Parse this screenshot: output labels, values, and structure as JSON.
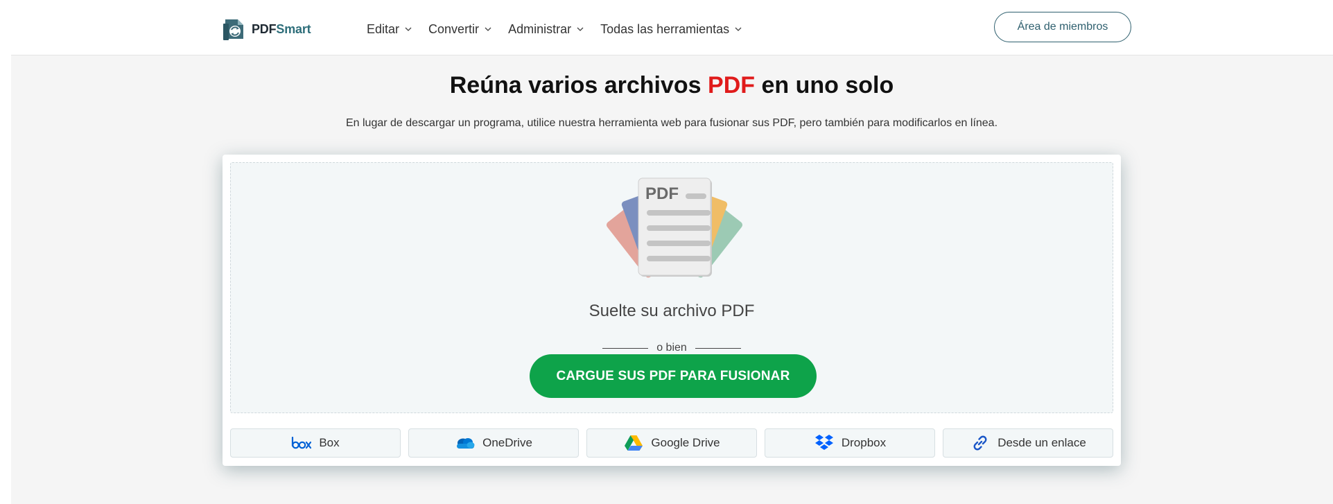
{
  "header": {
    "logo": {
      "pdf": "PDF",
      "smart": "Smart"
    },
    "nav": [
      {
        "label": "Editar"
      },
      {
        "label": "Convertir"
      },
      {
        "label": "Administrar"
      },
      {
        "label": "Todas las herramientas"
      }
    ],
    "member_button": "Área de miembros"
  },
  "hero": {
    "title_before": "Reúna varios archivos ",
    "title_accent": "PDF",
    "title_after": " en uno solo",
    "subtitle": "En lugar de descargar un programa, utilice nuestra herramienta web para fusionar sus PDF, pero también para modificarlos en línea."
  },
  "dropzone": {
    "illustration_label": "PDF",
    "drop_text": "Suelte su archivo PDF",
    "or_text": "o bien",
    "upload_button": "CARGUE SUS PDF PARA FUSIONAR"
  },
  "sources": [
    {
      "label": "Box",
      "icon": "box-icon"
    },
    {
      "label": "OneDrive",
      "icon": "onedrive-icon"
    },
    {
      "label": "Google Drive",
      "icon": "google-drive-icon"
    },
    {
      "label": "Dropbox",
      "icon": "dropbox-icon"
    },
    {
      "label": "Desde un enlace",
      "icon": "link-icon"
    }
  ],
  "colors": {
    "accent_red": "#e01b1b",
    "upload_green": "#0ea34a",
    "brand_teal": "#2e6e7a"
  }
}
